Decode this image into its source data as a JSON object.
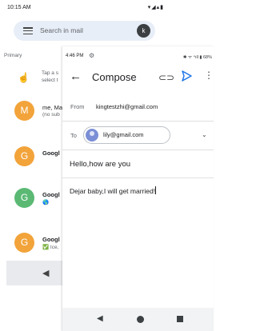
{
  "background": {
    "status_time": "10:15 AM",
    "status_icons": "▾◢▴▮",
    "search_placeholder": "Search in mail",
    "account_initial": "k",
    "section_label": "Primary",
    "hint_text": "Tap a s\nselect t",
    "mails": [
      {
        "initial": "M",
        "color": "#f2a33a",
        "sender": "me, Ma",
        "snippet": "(no sub",
        "bold": false
      },
      {
        "initial": "G",
        "color": "#f2a33a",
        "sender": "Googl",
        "snippet": "",
        "bold": true
      },
      {
        "initial": "G",
        "color": "#5bb974",
        "sender": "Googl",
        "snippet": "🌎",
        "bold": true
      },
      {
        "initial": "G",
        "color": "#f2a33a",
        "sender": "Googl",
        "snippet": "✅ Ice,",
        "bold": true
      }
    ],
    "nav_back": "◀"
  },
  "compose": {
    "status_time": "4:46 PM",
    "status_icons": "✱ ᯤ ⁴ıll ▮ 68%",
    "title": "Compose",
    "from_label": "From",
    "from_value": "kingtestzhi@gmail.com",
    "to_label": "To",
    "to_chip": "lily@gmail.com",
    "subject": "Hello,how are you",
    "body": "Dejar baby,I will get married!",
    "nav": {
      "back": "◀"
    }
  },
  "colors": {
    "accent": "#1a73e8",
    "chip_avatar": "#7b8fd6"
  }
}
